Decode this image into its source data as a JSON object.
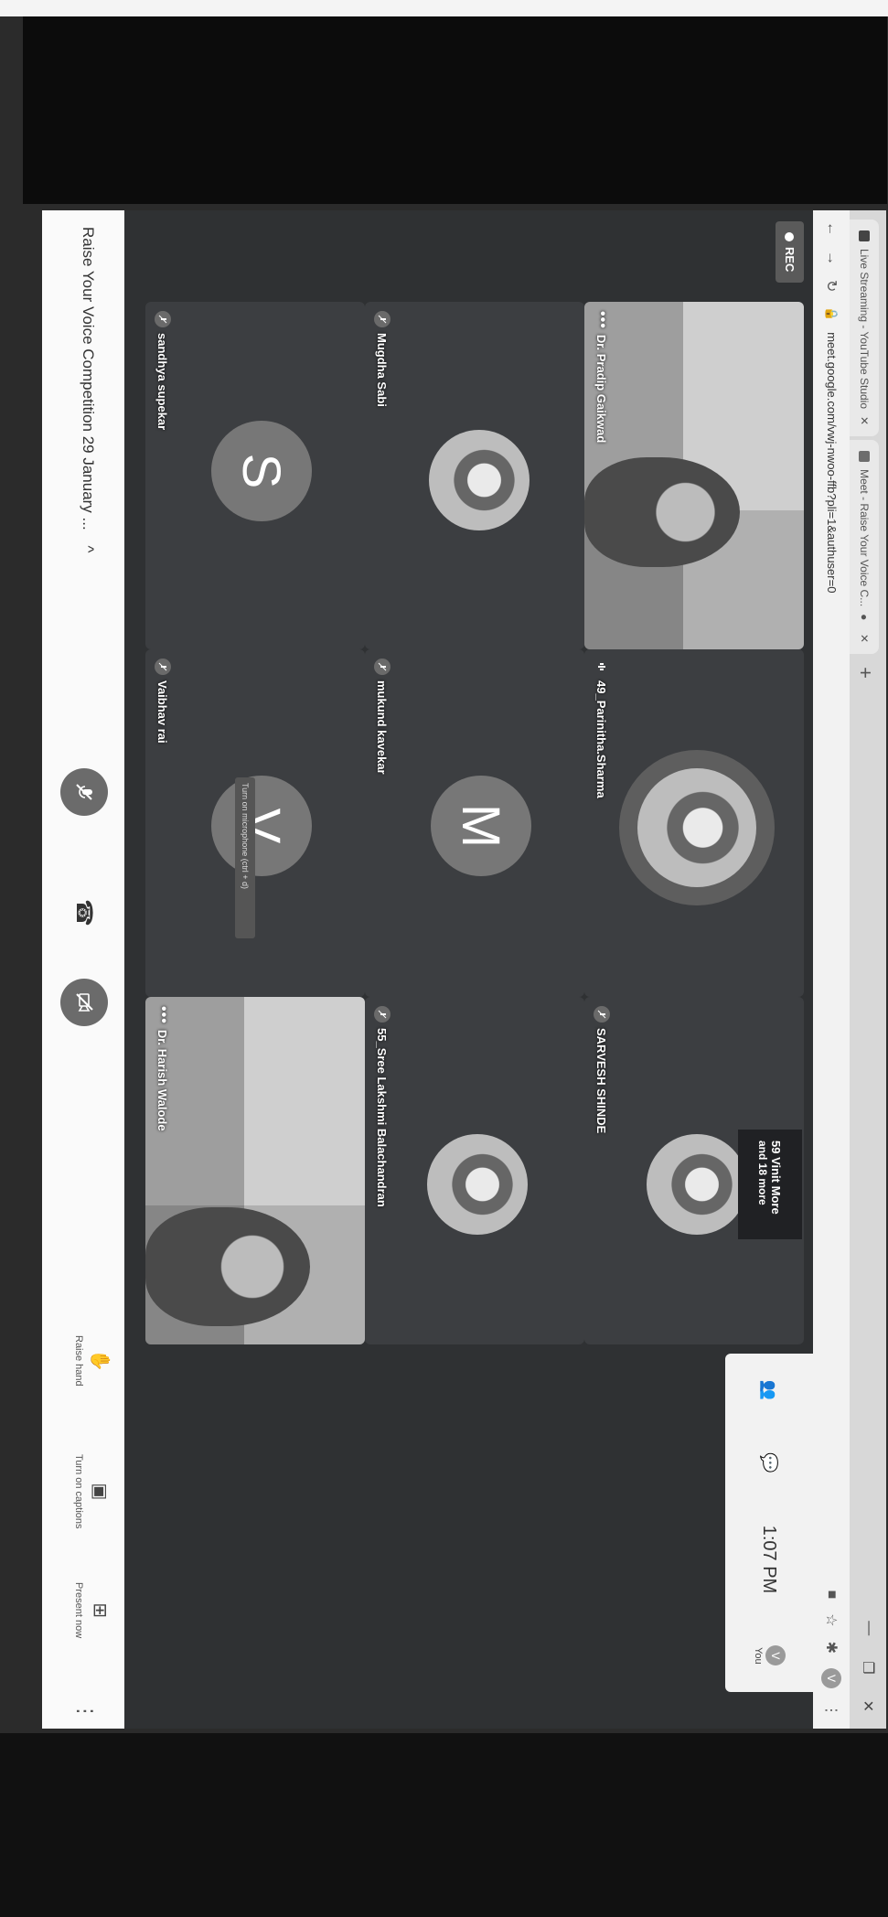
{
  "browser": {
    "tabs": [
      {
        "title": "Live Streaming - YouTube Studio"
      },
      {
        "title": "Meet - Raise Your Voice C..."
      }
    ],
    "url": "meet.google.com/vwj-nwoo-ffb?pli=1&authuser=0"
  },
  "meeting": {
    "rec_label": "REC",
    "clock": "1:07 PM",
    "you_label": "You",
    "more": {
      "line1": "59 Vinit More",
      "line2": "and 18 more"
    },
    "tooltip": "Turn on microphone (ctrl + d)",
    "title": "Raise Your Voice Competition 29 January ...",
    "participants": [
      {
        "name": "Dr. Pradip Gaikwad",
        "kind": "video"
      },
      {
        "name": "49_Parinitha.Sharma",
        "kind": "photo"
      },
      {
        "name": "SARVESH SHINDE",
        "kind": "photo"
      },
      {
        "name": "Mugdha Sabi",
        "kind": "photo"
      },
      {
        "name": "mukund kavekar",
        "kind": "letter",
        "letter": "M"
      },
      {
        "name": "55_Sree Lakshmi Balachandran",
        "kind": "photo"
      },
      {
        "name": "sandhya supekar",
        "kind": "letter",
        "letter": "S"
      },
      {
        "name": "Vaibhav rai",
        "kind": "letter",
        "letter": "V"
      },
      {
        "name": "Dr. Harish Walode",
        "kind": "video"
      }
    ],
    "actions": [
      {
        "label": "Raise hand",
        "icon": "hand-icon"
      },
      {
        "label": "Turn on captions",
        "icon": "captions-icon"
      },
      {
        "label": "Present now",
        "icon": "present-icon"
      }
    ]
  }
}
